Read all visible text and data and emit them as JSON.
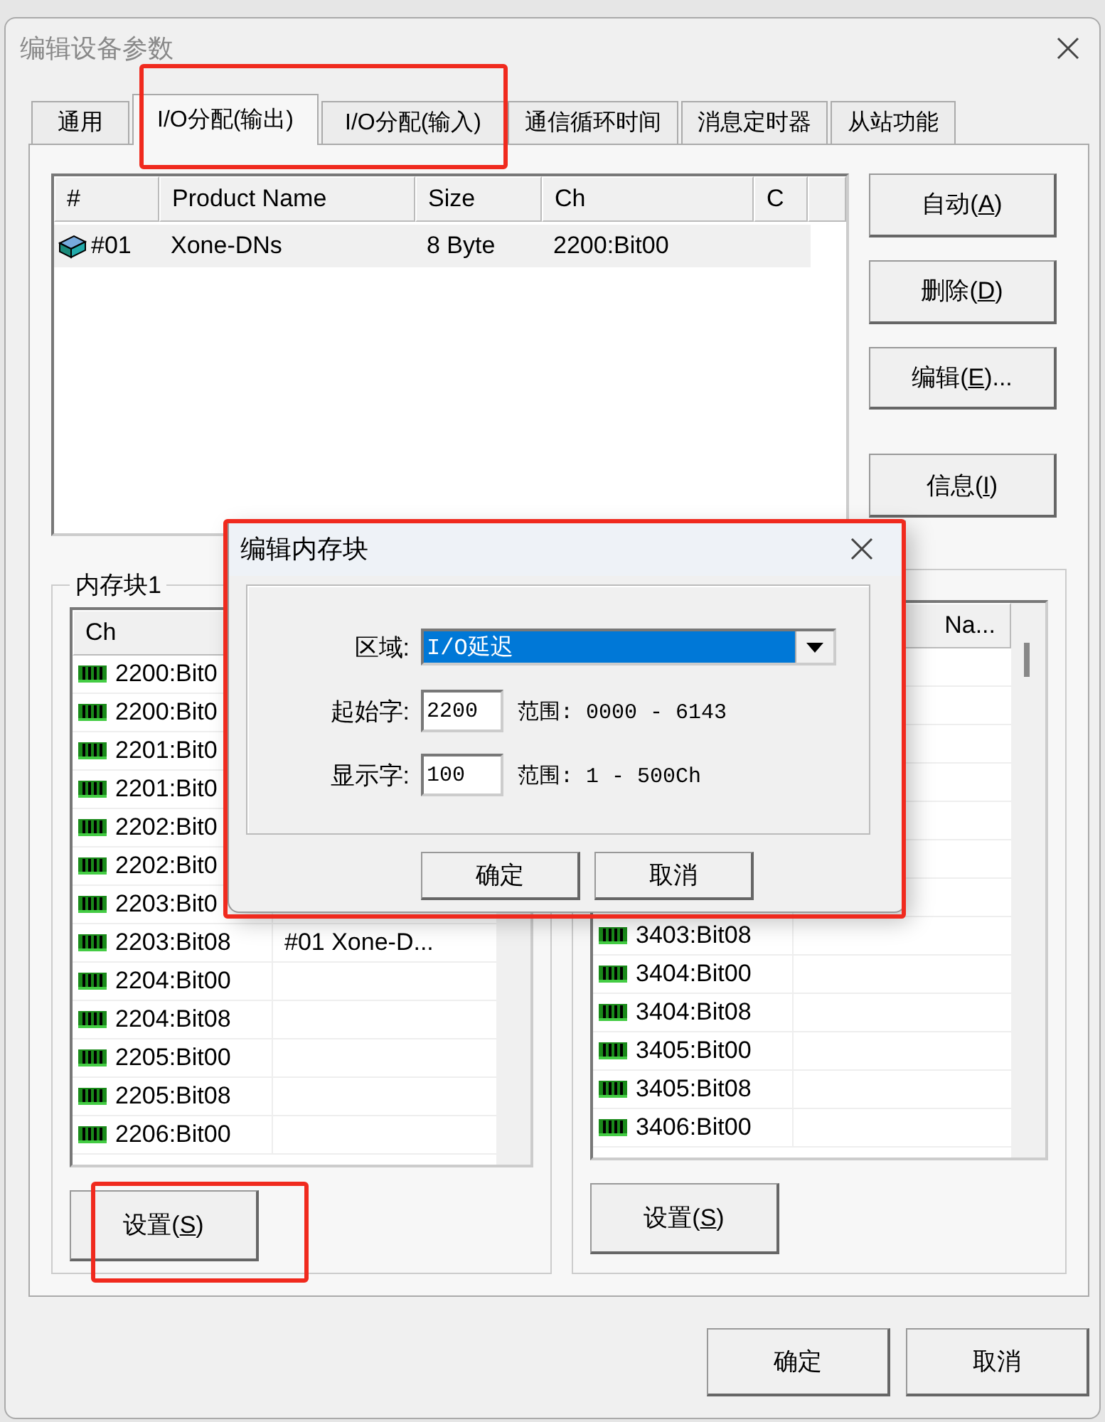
{
  "window": {
    "title": "编辑设备参数"
  },
  "tabs": [
    {
      "label": "通用",
      "selected": false
    },
    {
      "label": "I/O分配(输出)",
      "selected": true
    },
    {
      "label": "I/O分配(输入)",
      "selected": false
    },
    {
      "label": "通信循环时间",
      "selected": false
    },
    {
      "label": "消息定时器",
      "selected": false
    },
    {
      "label": "从站功能",
      "selected": false
    }
  ],
  "device_table": {
    "columns": [
      "#",
      "Product Name",
      "Size",
      "Ch",
      "C"
    ],
    "rows": [
      {
        "no": "#01",
        "product": "Xone-DNs",
        "size": "8 Byte",
        "ch": "2200:Bit00",
        "selected": true
      }
    ]
  },
  "side_buttons": [
    {
      "before": "自动(",
      "key": "A",
      "after": ")"
    },
    {
      "before": "删除(",
      "key": "D",
      "after": ")"
    },
    {
      "before": "编辑(",
      "key": "E",
      "after": ")..."
    },
    {
      "before": "信息(",
      "key": "I",
      "after": ")"
    }
  ],
  "memory_blocks": [
    {
      "title": "内存块1",
      "header": {
        "ch": "Ch"
      },
      "rows": [
        {
          "ch": "2200:Bit0"
        },
        {
          "ch": "2200:Bit0"
        },
        {
          "ch": "2201:Bit0"
        },
        {
          "ch": "2201:Bit0"
        },
        {
          "ch": "2202:Bit0"
        },
        {
          "ch": "2202:Bit0"
        },
        {
          "ch": "2203:Bit0"
        },
        {
          "ch": "2203:Bit08",
          "product": "#01 Xone-D..."
        },
        {
          "ch": "2204:Bit00"
        },
        {
          "ch": "2204:Bit08"
        },
        {
          "ch": "2205:Bit00"
        },
        {
          "ch": "2205:Bit08"
        },
        {
          "ch": "2206:Bit00"
        }
      ],
      "button": {
        "before": "设置(",
        "key": "S",
        "after": ")"
      }
    },
    {
      "header": {
        "product": "Na..."
      },
      "rows": [
        {
          "ch": "3403:Bit08"
        },
        {
          "ch": "3404:Bit00"
        },
        {
          "ch": "3404:Bit08"
        },
        {
          "ch": "3405:Bit00"
        },
        {
          "ch": "3405:Bit08"
        },
        {
          "ch": "3406:Bit00"
        }
      ],
      "button": {
        "before": "设置(",
        "key": "S",
        "after": ")"
      }
    }
  ],
  "footer_buttons": [
    "确定",
    "取消"
  ],
  "dialog": {
    "title": "编辑内存块",
    "area": {
      "label": "区域:",
      "value": "I/O延迟"
    },
    "fields": [
      {
        "label": "起始字:",
        "value": "2200",
        "range": "范围: 0000 - 6143"
      },
      {
        "label": "显示字:",
        "value": "100",
        "range": "范围: 1 - 500Ch"
      }
    ],
    "buttons": [
      "确定",
      "取消"
    ]
  }
}
